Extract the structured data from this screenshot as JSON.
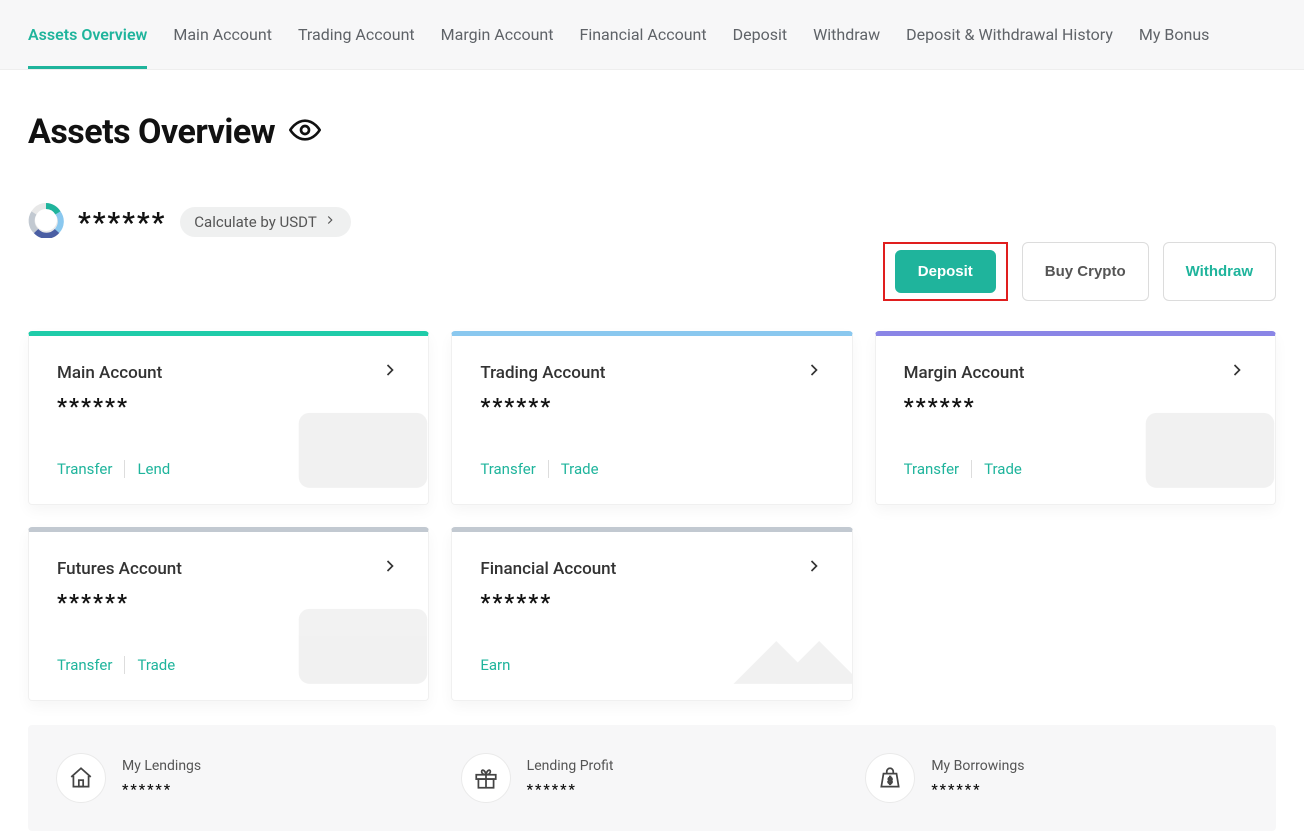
{
  "tabs": [
    {
      "label": "Assets Overview",
      "active": true
    },
    {
      "label": "Main Account"
    },
    {
      "label": "Trading Account"
    },
    {
      "label": "Margin Account"
    },
    {
      "label": "Financial Account"
    },
    {
      "label": "Deposit"
    },
    {
      "label": "Withdraw"
    },
    {
      "label": "Deposit & Withdrawal History"
    },
    {
      "label": "My Bonus"
    }
  ],
  "page_title": "Assets Overview",
  "balance_masked": "******",
  "calc_chip_label": "Calculate by USDT",
  "actions": {
    "deposit": "Deposit",
    "buy_crypto": "Buy Crypto",
    "withdraw": "Withdraw"
  },
  "cards": [
    {
      "title": "Main Account",
      "value": "******",
      "links": [
        "Transfer",
        "Lend"
      ],
      "color": "green"
    },
    {
      "title": "Trading Account",
      "value": "******",
      "links": [
        "Transfer",
        "Trade"
      ],
      "color": "blue"
    },
    {
      "title": "Margin Account",
      "value": "******",
      "links": [
        "Transfer",
        "Trade"
      ],
      "color": "purple"
    },
    {
      "title": "Futures Account",
      "value": "******",
      "links": [
        "Transfer",
        "Trade"
      ],
      "color": "grey"
    },
    {
      "title": "Financial Account",
      "value": "******",
      "links": [
        "Earn"
      ],
      "color": "steel"
    }
  ],
  "stats": [
    {
      "label": "My Lendings",
      "value": "******",
      "icon": "house"
    },
    {
      "label": "Lending Profit",
      "value": "******",
      "icon": "gift"
    },
    {
      "label": "My Borrowings",
      "value": "******",
      "icon": "bag"
    }
  ],
  "colors": {
    "accent": "#1fb49c",
    "highlight": "#e01e1e"
  }
}
